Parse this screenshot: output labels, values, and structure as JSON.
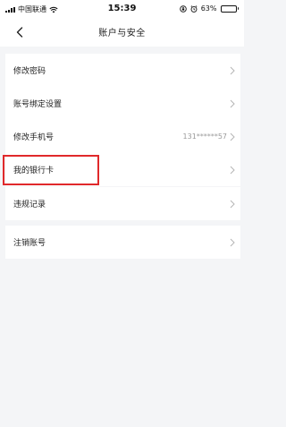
{
  "status_bar": {
    "carrier": "中国联通",
    "time": "15:39",
    "battery_percent": "63%",
    "battery_level": 0.63
  },
  "navbar": {
    "title": "账户与安全"
  },
  "groups": [
    [
      {
        "label": "修改密码",
        "value": ""
      },
      {
        "label": "账号绑定设置",
        "value": ""
      },
      {
        "label": "修改手机号",
        "value": "131******57"
      },
      {
        "label": "我的银行卡",
        "value": ""
      }
    ],
    [
      {
        "label": "违规记录",
        "value": ""
      }
    ],
    [
      {
        "label": "注销账号",
        "value": ""
      }
    ]
  ],
  "colors": {
    "background": "#f4f5f7",
    "card": "#ffffff",
    "text": "#222222",
    "secondary_text": "#9a9a9a",
    "highlight_border": "#e0292b"
  }
}
